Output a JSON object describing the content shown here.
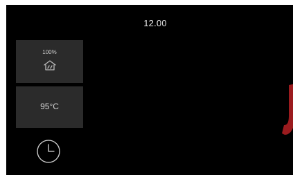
{
  "header": {
    "time": "12.00"
  },
  "controls": {
    "steam": {
      "level": "100%",
      "icon": "steam-icon"
    },
    "temperature": {
      "value": "95°C"
    },
    "timer": {
      "icon": "clock-icon"
    }
  },
  "colors": {
    "screen_background": "#000000",
    "tile_background": "#2b2b2b",
    "text": "#e6e6e6",
    "brand_mark": "#9b1b1e"
  }
}
